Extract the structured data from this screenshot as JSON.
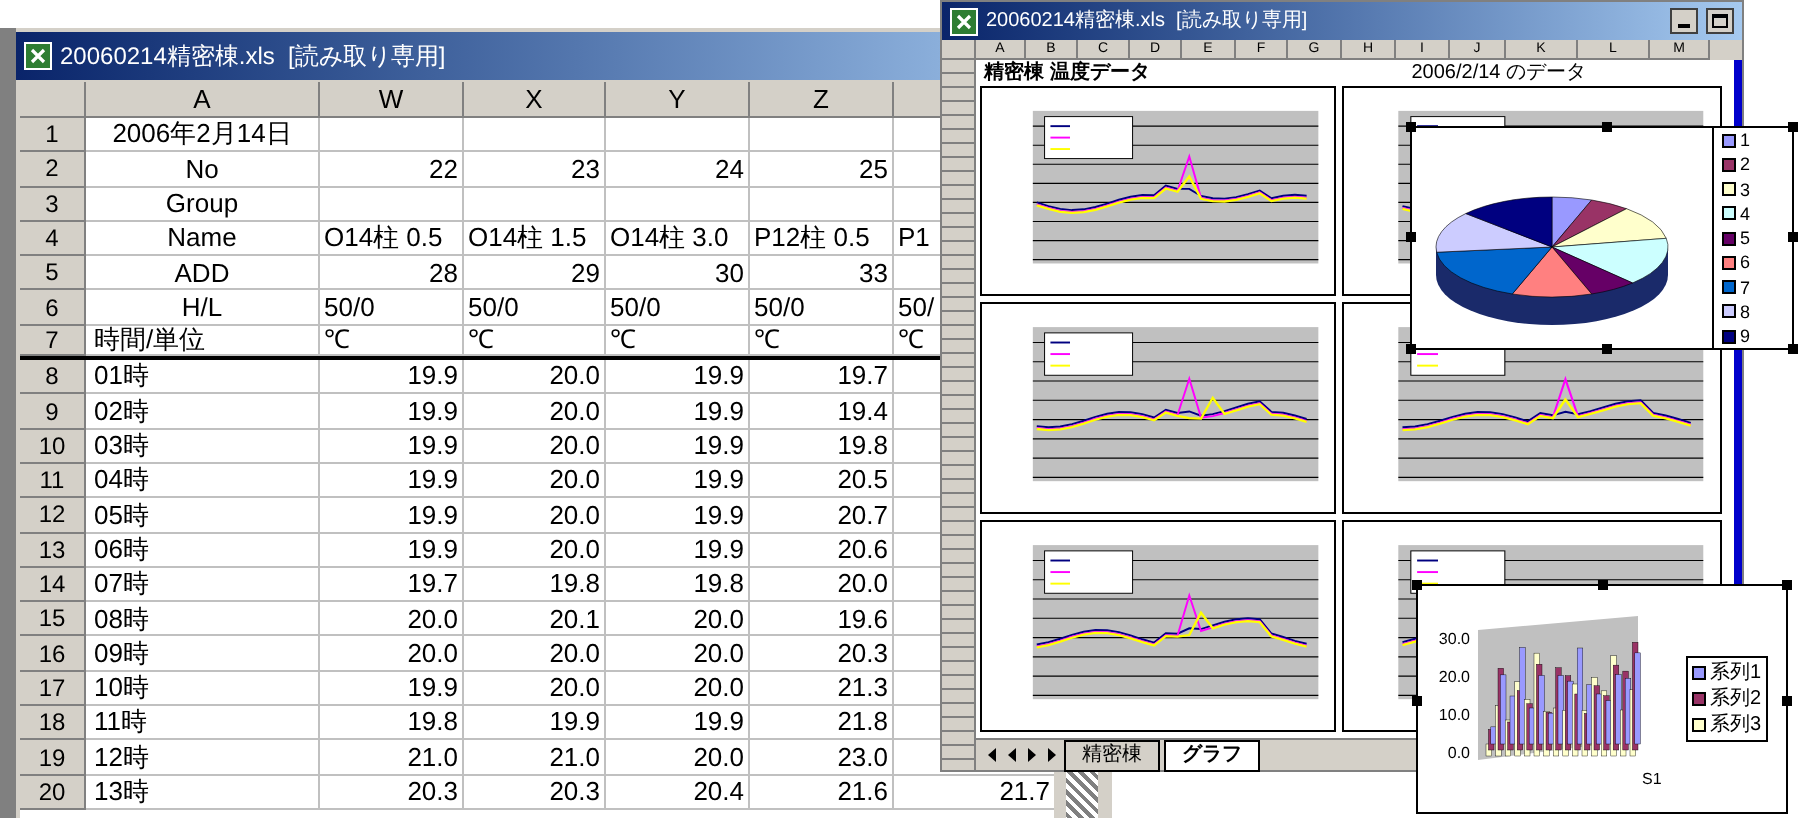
{
  "sheet_window": {
    "title": "20060214精密棟.xls  [読み取り専用]",
    "columns": [
      "A",
      "W",
      "X",
      "Y",
      "Z"
    ],
    "rows": [
      {
        "num": "1",
        "label": "2006年2月14日",
        "kind": "text",
        "cells": []
      },
      {
        "num": "2",
        "label": "No",
        "kind": "number",
        "cells": [
          "22",
          "23",
          "24",
          "25"
        ]
      },
      {
        "num": "3",
        "label": "Group",
        "kind": "text",
        "cells": []
      },
      {
        "num": "4",
        "label": "Name",
        "kind": "text",
        "cells": [
          "O14柱 0.5",
          "O14柱 1.5",
          "O14柱 3.0",
          "P12柱 0.5",
          "P1"
        ]
      },
      {
        "num": "5",
        "label": "ADD",
        "kind": "number",
        "cells": [
          "28",
          "29",
          "30",
          "33"
        ]
      },
      {
        "num": "6",
        "label": "H/L",
        "kind": "text",
        "cells": [
          "50/0",
          "50/0",
          "50/0",
          "50/0",
          "50/"
        ]
      },
      {
        "num": "7",
        "label": "時間/単位",
        "kind": "text",
        "cells": [
          "℃",
          "℃",
          "℃",
          "℃",
          "℃"
        ]
      },
      {
        "num": "8",
        "label": "01時",
        "kind": "number",
        "cells": [
          "19.9",
          "20.0",
          "19.9",
          "19.7"
        ]
      },
      {
        "num": "9",
        "label": "02時",
        "kind": "number",
        "cells": [
          "19.9",
          "20.0",
          "19.9",
          "19.4"
        ]
      },
      {
        "num": "10",
        "label": "03時",
        "kind": "number",
        "cells": [
          "19.9",
          "20.0",
          "19.9",
          "19.8"
        ]
      },
      {
        "num": "11",
        "label": "04時",
        "kind": "number",
        "cells": [
          "19.9",
          "20.0",
          "19.9",
          "20.5"
        ]
      },
      {
        "num": "12",
        "label": "05時",
        "kind": "number",
        "cells": [
          "19.9",
          "20.0",
          "19.9",
          "20.7"
        ]
      },
      {
        "num": "13",
        "label": "06時",
        "kind": "number",
        "cells": [
          "19.9",
          "20.0",
          "19.9",
          "20.6"
        ]
      },
      {
        "num": "14",
        "label": "07時",
        "kind": "number",
        "cells": [
          "19.7",
          "19.8",
          "19.8",
          "20.0"
        ]
      },
      {
        "num": "15",
        "label": "08時",
        "kind": "number",
        "cells": [
          "20.0",
          "20.1",
          "20.0",
          "19.6"
        ]
      },
      {
        "num": "16",
        "label": "09時",
        "kind": "number",
        "cells": [
          "20.0",
          "20.0",
          "20.0",
          "20.3"
        ]
      },
      {
        "num": "17",
        "label": "10時",
        "kind": "number",
        "cells": [
          "19.9",
          "20.0",
          "20.0",
          "21.3"
        ]
      },
      {
        "num": "18",
        "label": "11時",
        "kind": "number",
        "cells": [
          "19.8",
          "19.9",
          "19.9",
          "21.8"
        ]
      },
      {
        "num": "19",
        "label": "12時",
        "kind": "number",
        "cells": [
          "21.0",
          "21.0",
          "20.0",
          "23.0"
        ]
      },
      {
        "num": "20",
        "label": "13時",
        "kind": "number",
        "cells": [
          "20.3",
          "20.3",
          "20.4",
          "21.6",
          "21.7"
        ]
      }
    ]
  },
  "chart_window": {
    "title": "20060214精密棟.xls  [読み取り専用]",
    "columns": [
      "A",
      "B",
      "C",
      "D",
      "E",
      "F",
      "G",
      "H",
      "I",
      "J",
      "K",
      "L",
      "M"
    ],
    "sheet_heading": "精密棟 温度データ",
    "sheet_date": "2006/2/14 のデータ",
    "tabs": [
      {
        "label": "精密棟",
        "selected": false
      },
      {
        "label": "グラフ",
        "selected": true
      }
    ]
  },
  "pie_chart": {
    "legend": [
      {
        "label": "1",
        "color": "#9999ff"
      },
      {
        "label": "2",
        "color": "#993366"
      },
      {
        "label": "3",
        "color": "#ffffcc"
      },
      {
        "label": "4",
        "color": "#ccffff"
      },
      {
        "label": "5",
        "color": "#660066"
      },
      {
        "label": "6",
        "color": "#ff8080"
      },
      {
        "label": "7",
        "color": "#0066cc"
      },
      {
        "label": "8",
        "color": "#ccccff"
      },
      {
        "label": "9",
        "color": "#000080"
      }
    ]
  },
  "bar_chart": {
    "axis_labels": [
      "30.0",
      "20.0",
      "10.0",
      "0.0"
    ],
    "series_label": "S1",
    "legend": [
      {
        "label": "系列1",
        "color": "#9999ff"
      },
      {
        "label": "系列2",
        "color": "#993366"
      },
      {
        "label": "系列3",
        "color": "#ffffcc"
      }
    ]
  }
}
